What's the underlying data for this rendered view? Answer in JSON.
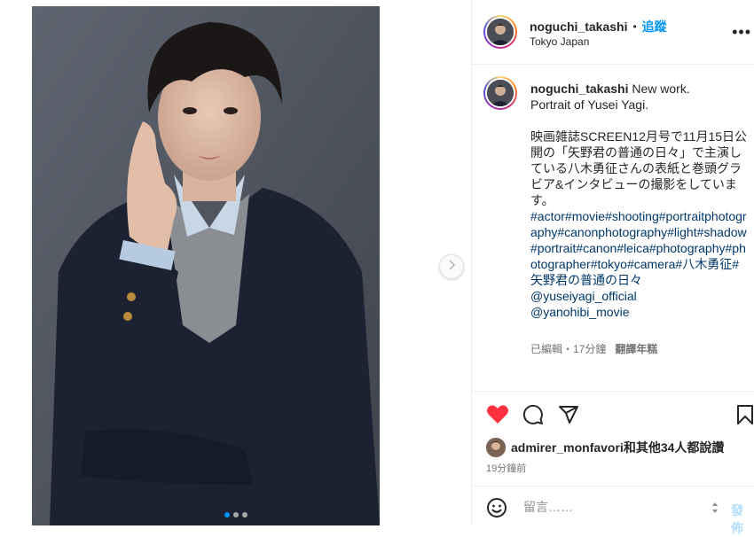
{
  "post": {
    "username": "noguchi_takashi",
    "separator": "•",
    "follow_label": "追蹤",
    "location": "Tokyo Japan",
    "more_label": "•••"
  },
  "caption": {
    "username": "noguchi_takashi",
    "text": " New work.\nPortrait of Yusei Yagi.\n\n映画雑誌SCREEN12月号で11月15日公開の「矢野君の普通の日々」で主演している八木勇征さんの表紙と巻頭グラビア&インタビューの撮影をしています。\n",
    "hashtags": "#actor#movie#shooting#portraitphotography#canonphotography#light#shadow#portrait#canon#leica#photography#photographer#tokyo#camera#八木勇征#矢野君の普通の日々",
    "mention1": "@yuseiyagi_official",
    "mention2": "@yanohibi_movie",
    "edited": "已編輯・17分鐘",
    "translate": "翻譯年糕"
  },
  "likes": {
    "user": "admirer_monfavori",
    "suffix": "和其他34人都說讚"
  },
  "time_ago": "19分鐘前",
  "comment": {
    "placeholder": "留言……",
    "post_label": "發佈"
  },
  "carousel": {
    "total": 3,
    "active_index": 0
  },
  "colors": {
    "accent": "#0095f6",
    "like_red": "#ff3040",
    "hashtag": "#00376b"
  },
  "icons": [
    "chevron-right-icon",
    "heart-icon",
    "comment-icon",
    "share-icon",
    "bookmark-icon",
    "emoji-icon",
    "more-icon"
  ]
}
